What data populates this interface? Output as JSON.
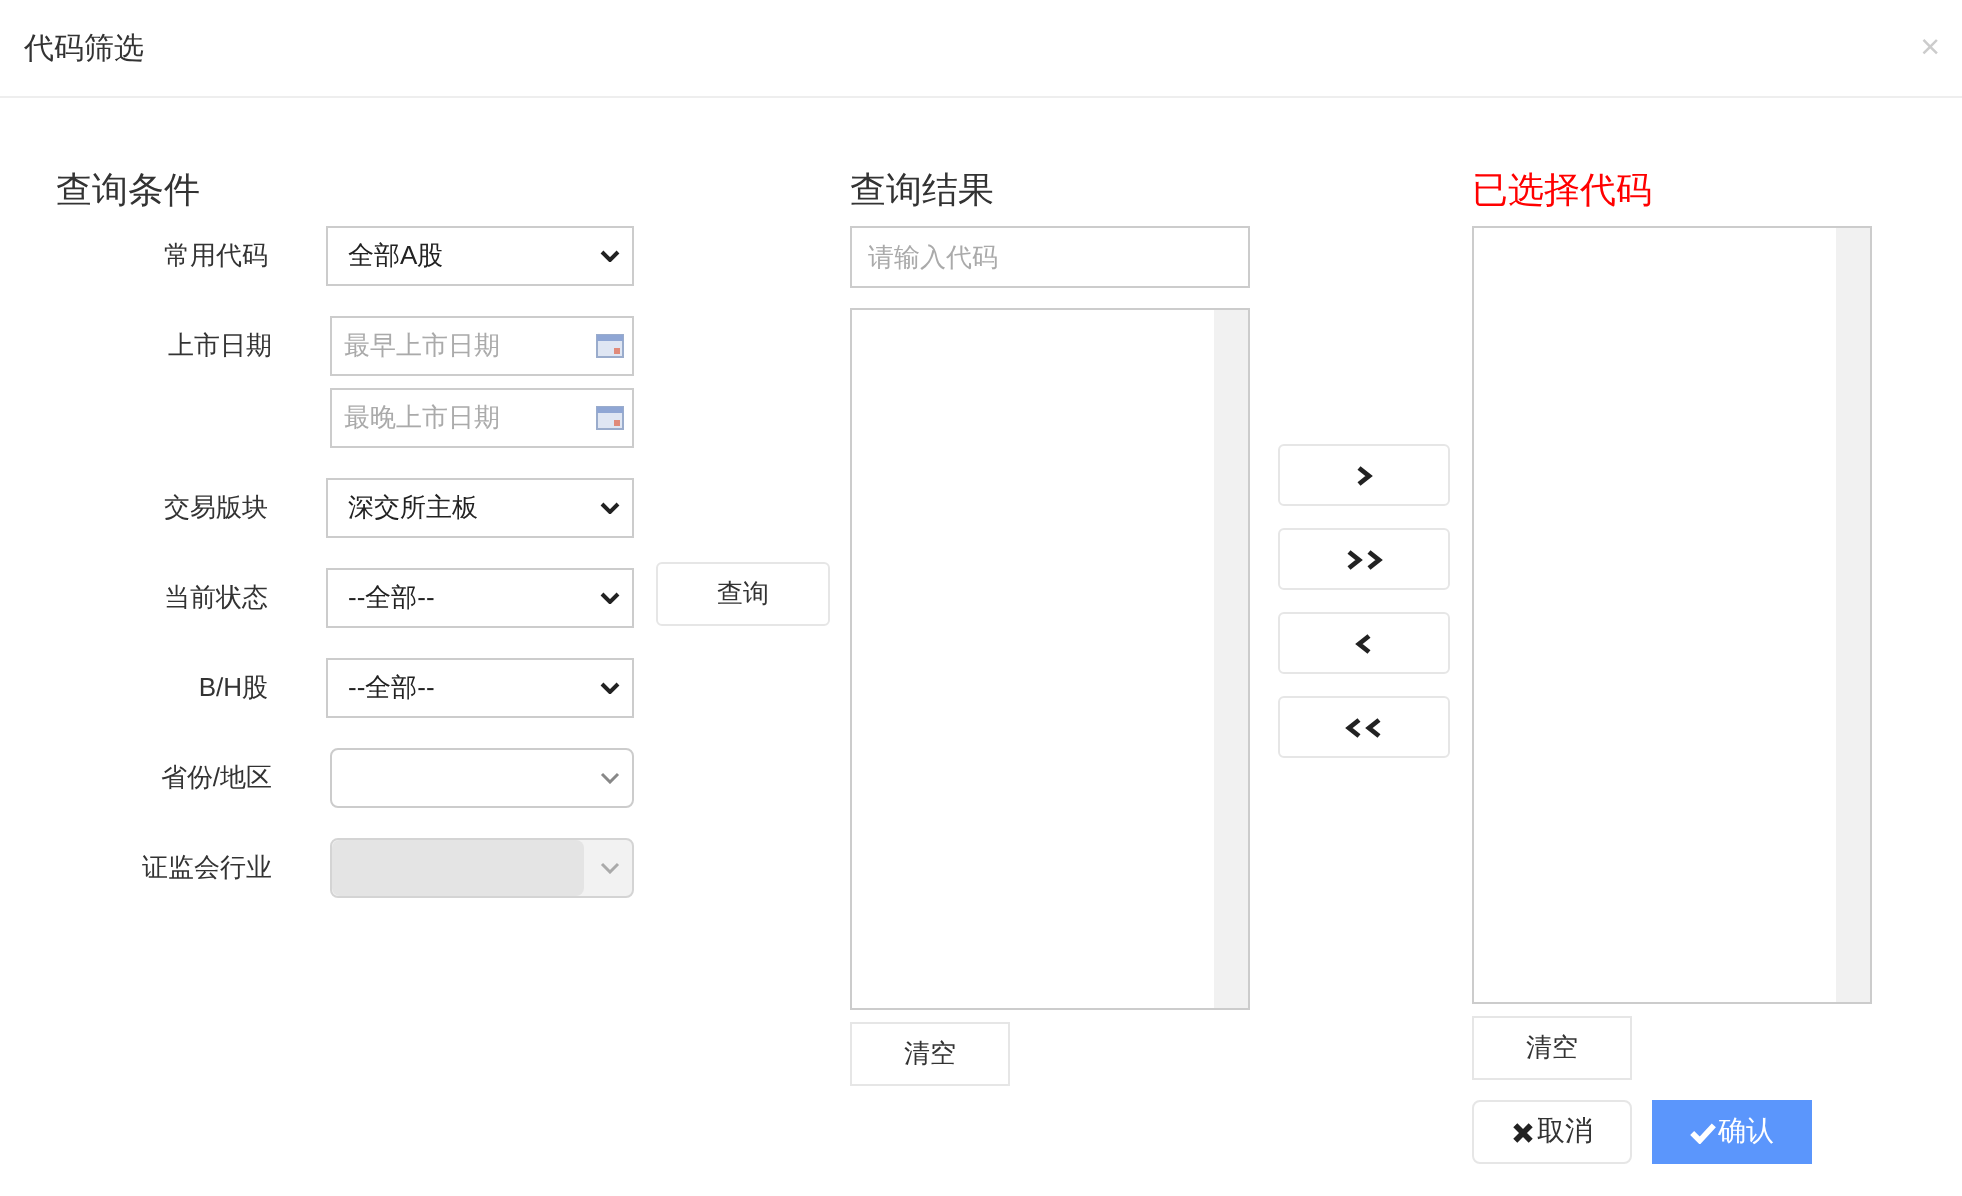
{
  "window": {
    "title": "代码筛选",
    "close": "×"
  },
  "criteria": {
    "heading": "查询条件",
    "fields": [
      {
        "label": "常用代码",
        "kind": "select",
        "value": "全部A股"
      },
      {
        "label": "上市日期",
        "kind": "dates",
        "placeholders": [
          "最早上市日期",
          "最晚上市日期"
        ]
      },
      {
        "label": "交易版块",
        "kind": "select",
        "value": "深交所主板"
      },
      {
        "label": "当前状态",
        "kind": "select",
        "value": "--全部--"
      },
      {
        "label": "B/H股",
        "kind": "select",
        "value": "--全部--"
      },
      {
        "label": "省份/地区",
        "kind": "combo",
        "disabled": false
      },
      {
        "label": "证监会行业",
        "kind": "combo",
        "disabled": true
      }
    ],
    "query_button": "查询"
  },
  "results": {
    "heading": "查询结果",
    "search": {
      "placeholder": "请输入代码"
    },
    "clear_button": "清空"
  },
  "move_buttons": [
    {
      "kind": "one-right"
    },
    {
      "kind": "all-right"
    },
    {
      "kind": "one-left"
    },
    {
      "kind": "all-left"
    }
  ],
  "selected": {
    "heading": "已选择代码",
    "clear_button": "清空",
    "cancel_button": "取消",
    "confirm_button": "确认"
  }
}
